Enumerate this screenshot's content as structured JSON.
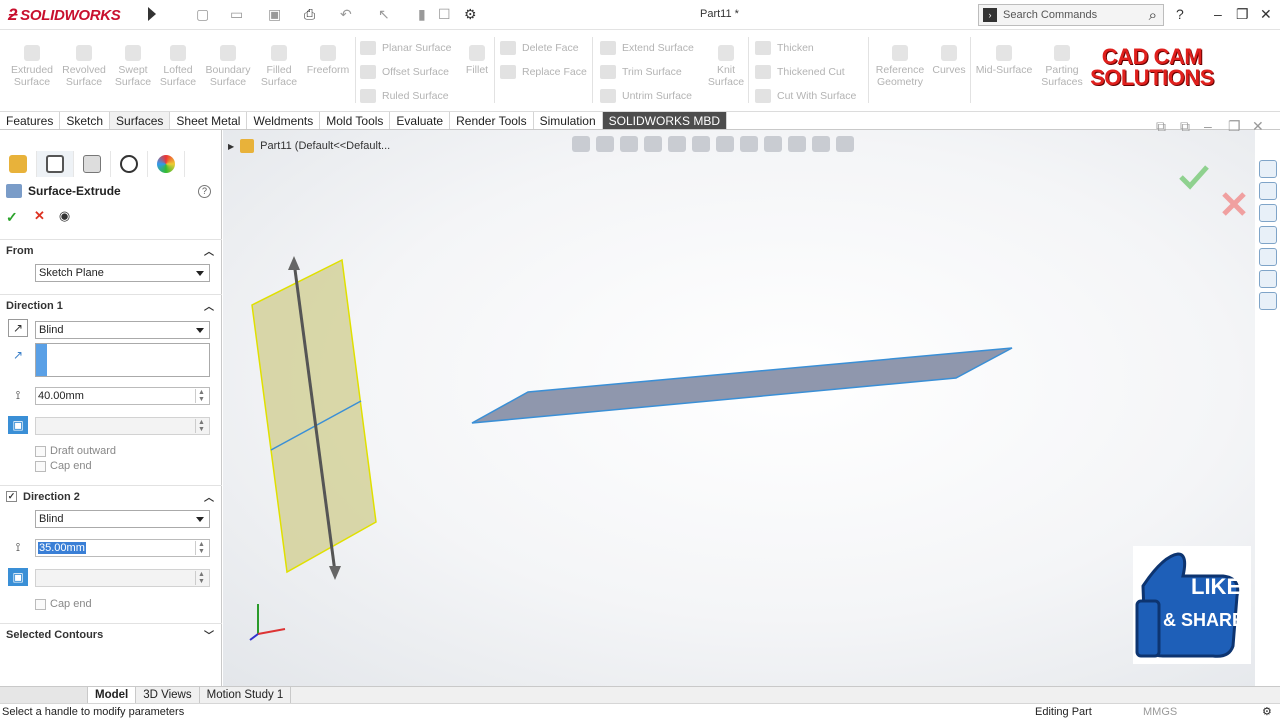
{
  "app": {
    "brand": "SOLIDWORKS",
    "document_title": "Part11 *"
  },
  "search": {
    "placeholder": "Search Commands"
  },
  "command_manager": {
    "large": [
      {
        "label1": "Extruded",
        "label2": "Surface"
      },
      {
        "label1": "Revolved",
        "label2": "Surface"
      },
      {
        "label1": "Swept",
        "label2": "Surface"
      },
      {
        "label1": "Lofted",
        "label2": "Surface"
      },
      {
        "label1": "Boundary",
        "label2": "Surface"
      },
      {
        "label1": "Filled",
        "label2": "Surface"
      },
      {
        "label1": "Freeform",
        "label2": ""
      },
      {
        "label1": "Fillet",
        "label2": ""
      },
      {
        "label1": "Knit",
        "label2": "Surface"
      },
      {
        "label1": "Reference",
        "label2": "Geometry"
      },
      {
        "label1": "Curves",
        "label2": ""
      },
      {
        "label1": "Mid-Surface",
        "label2": ""
      },
      {
        "label1": "Parting",
        "label2": "Surfaces"
      }
    ],
    "small": {
      "planar_surface": "Planar Surface",
      "offset_surface": "Offset Surface",
      "ruled_surface": "Ruled Surface",
      "delete_face": "Delete Face",
      "replace_face": "Replace Face",
      "extend_surface": "Extend Surface",
      "trim_surface": "Trim Surface",
      "untrim_surface": "Untrim Surface",
      "thicken": "Thicken",
      "thickened_cut": "Thickened Cut",
      "cut_with_surface": "Cut With Surface"
    },
    "brand_line1": "CAD CAM",
    "brand_line2": "SOLUTIONS"
  },
  "tabs": [
    "Features",
    "Sketch",
    "Surfaces",
    "Sheet Metal",
    "Weldments",
    "Mold Tools",
    "Evaluate",
    "Render Tools",
    "Simulation",
    "SOLIDWORKS MBD"
  ],
  "property_manager": {
    "title": "Surface-Extrude",
    "from": {
      "label": "From",
      "value": "Sketch Plane"
    },
    "direction1": {
      "label": "Direction 1",
      "end_condition": "Blind",
      "depth": "40.00mm",
      "draft_outward": "Draft outward",
      "cap_end": "Cap end"
    },
    "direction2": {
      "label": "Direction 2",
      "end_condition": "Blind",
      "depth": "35.00mm",
      "cap_end": "Cap end"
    },
    "selected_contours": "Selected Contours"
  },
  "viewport": {
    "breadcrumb": "Part11  (Default<<Default..."
  },
  "bottom_tabs": [
    "Model",
    "3D Views",
    "Motion Study 1"
  ],
  "status": {
    "message": "Select a handle to modify parameters",
    "mode": "Editing Part",
    "units": "MMGS"
  },
  "like_share": {
    "line1": "LIKE",
    "line2": "& SHARE"
  },
  "colors": {
    "plane_fill": "#d4d19a",
    "plane_edge": "#e0e000",
    "surface_fill": "#8f97ad",
    "surface_edge": "#3a8fd6",
    "brand_red": "#e0201d"
  }
}
